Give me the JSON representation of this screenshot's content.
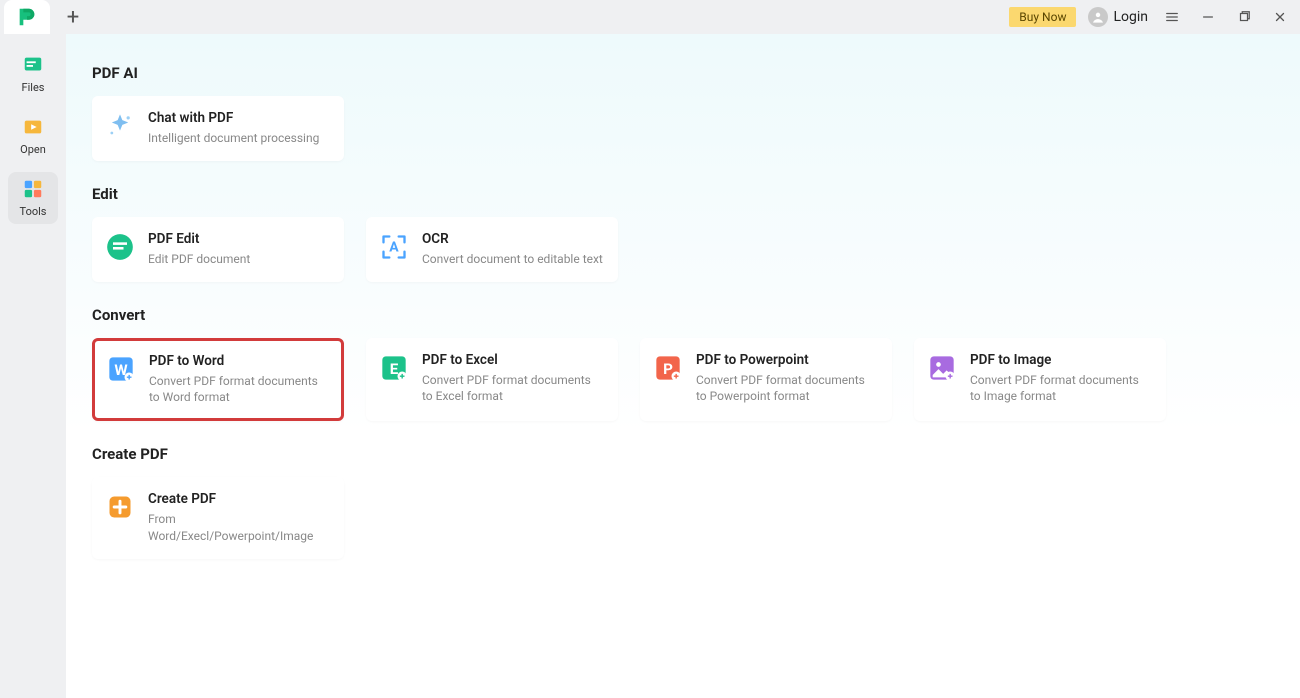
{
  "titlebar": {
    "buy_now": "Buy Now",
    "login": "Login"
  },
  "sidebar": {
    "items": [
      {
        "label": "Files"
      },
      {
        "label": "Open"
      },
      {
        "label": "Tools"
      }
    ]
  },
  "sections": {
    "pdf_ai": {
      "title": "PDF AI",
      "cards": [
        {
          "title": "Chat with PDF",
          "desc": "Intelligent document processing"
        }
      ]
    },
    "edit": {
      "title": "Edit",
      "cards": [
        {
          "title": "PDF Edit",
          "desc": "Edit PDF document"
        },
        {
          "title": "OCR",
          "desc": "Convert document to editable text"
        }
      ]
    },
    "convert": {
      "title": "Convert",
      "cards": [
        {
          "title": "PDF to Word",
          "desc": "Convert PDF format documents to Word format"
        },
        {
          "title": "PDF to Excel",
          "desc": "Convert PDF format documents to Excel format"
        },
        {
          "title": "PDF to Powerpoint",
          "desc": "Convert PDF format documents to Powerpoint format"
        },
        {
          "title": "PDF to Image",
          "desc": "Convert PDF format documents to Image format"
        }
      ]
    },
    "create": {
      "title": "Create PDF",
      "cards": [
        {
          "title": "Create PDF",
          "desc": "From Word/Execl/Powerpoint/Image"
        }
      ]
    }
  }
}
